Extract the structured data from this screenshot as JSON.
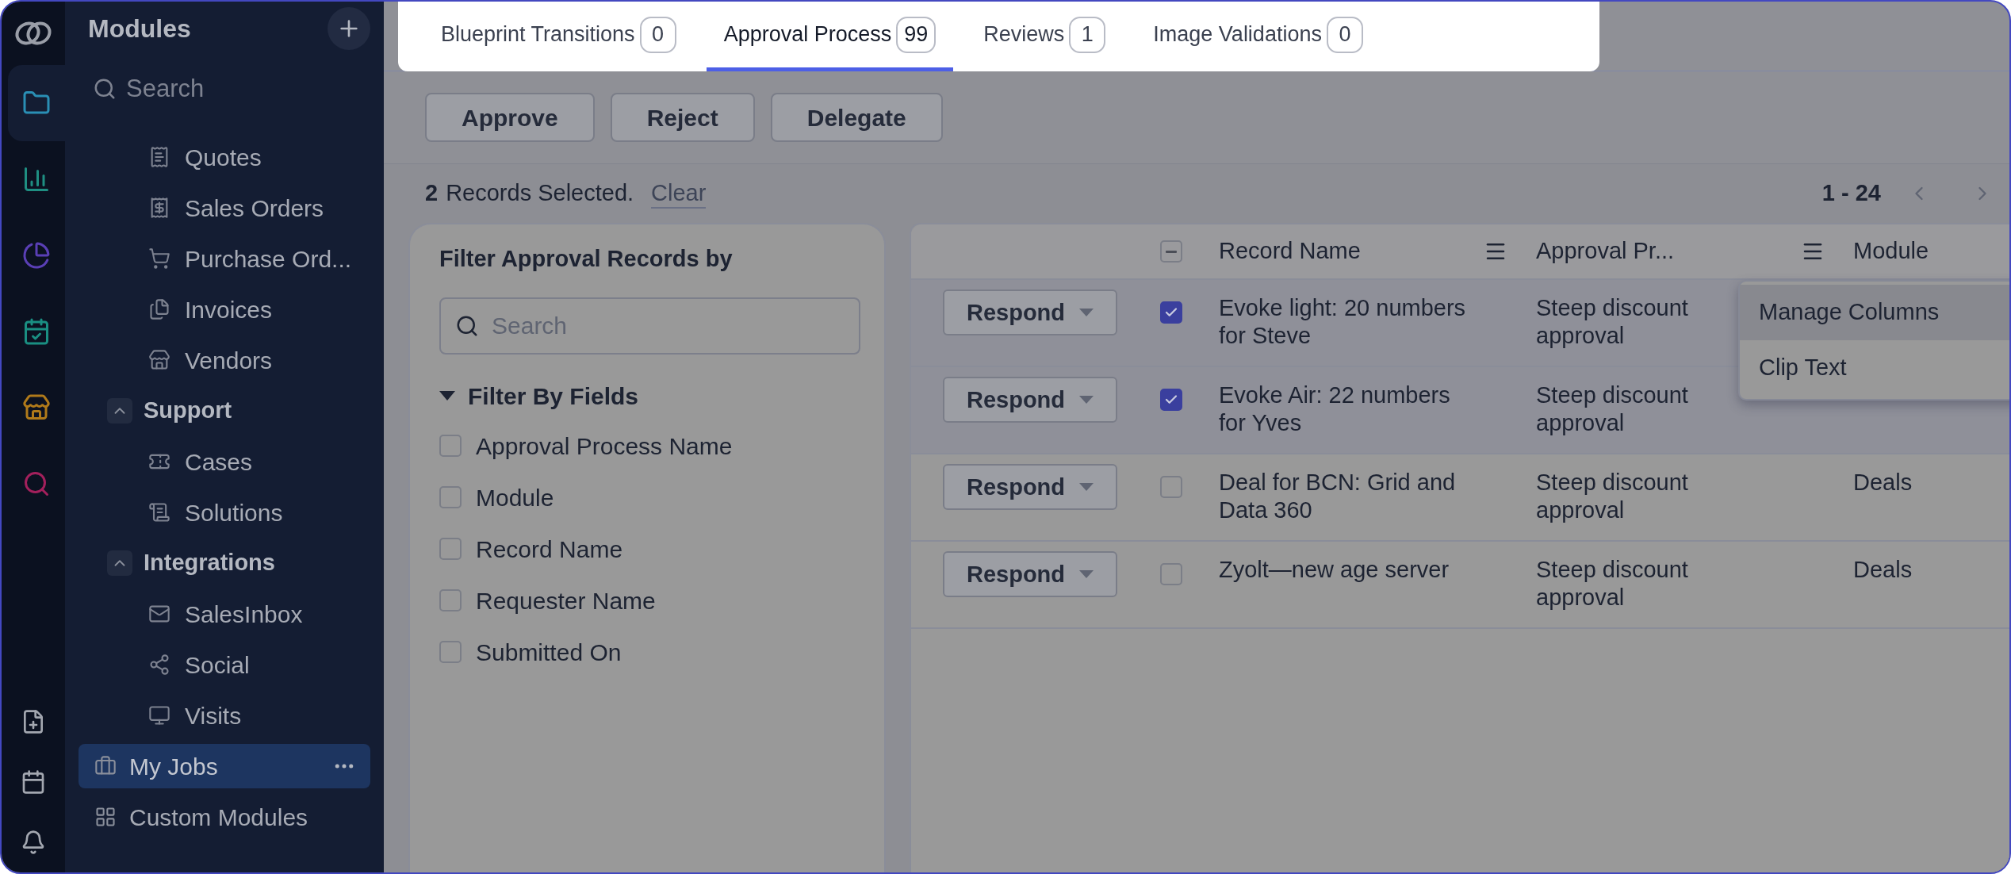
{
  "rail": {
    "top": [
      {
        "selected": true
      },
      {
        "selected": false
      },
      {
        "selected": false
      },
      {
        "selected": false
      },
      {
        "selected": false
      },
      {
        "selected": false
      }
    ],
    "bottom": [
      {
        "selected": false
      },
      {
        "selected": false
      },
      {
        "selected": false
      }
    ]
  },
  "sidebar": {
    "title": "Modules",
    "search": {
      "placeholder": "Search"
    },
    "sections": [
      {
        "children": [
          {
            "label": "Quotes"
          },
          {
            "label": "Sales Orders"
          },
          {
            "label": "Purchase Ord..."
          },
          {
            "label": "Invoices"
          },
          {
            "label": "Vendors"
          }
        ]
      },
      {
        "label": "Support",
        "expanded": true,
        "children": [
          {
            "label": "Cases"
          },
          {
            "label": "Solutions"
          }
        ]
      },
      {
        "label": "Integrations",
        "expanded": true,
        "children": [
          {
            "label": "SalesInbox"
          },
          {
            "label": "Social"
          },
          {
            "label": "Visits"
          }
        ]
      }
    ],
    "items": [
      {
        "label": "My Jobs",
        "selected": true
      },
      {
        "label": "Custom Modules",
        "selected": false
      }
    ]
  },
  "tabs": [
    {
      "label": "Blueprint Transitions",
      "count": "0",
      "selected": false
    },
    {
      "label": "Approval Process",
      "count": "99",
      "selected": true
    },
    {
      "label": "Reviews",
      "count": "1",
      "selected": false
    },
    {
      "label": "Image Validations",
      "count": "0",
      "selected": false
    }
  ],
  "toolbar": {
    "buttons": [
      "Approve",
      "Reject",
      "Delegate"
    ]
  },
  "selection": {
    "count": "2",
    "text": "Records Selected.",
    "link": "Clear"
  },
  "pagination": {
    "range": "1 - 24"
  },
  "filter": {
    "title": "Filter Approval Records by",
    "search": {
      "placeholder": "Search"
    },
    "section": {
      "label": "Filter By Fields",
      "expanded": true
    },
    "fields": [
      {
        "label": "Approval Process Name",
        "checked": false
      },
      {
        "label": "Module",
        "checked": false
      },
      {
        "label": "Record Name",
        "checked": false
      },
      {
        "label": "Requester Name",
        "checked": false
      },
      {
        "label": "Submitted On",
        "checked": false
      }
    ]
  },
  "table": {
    "header_indeterminate": true,
    "columns": [
      "Record Name",
      "Approval Pr...",
      "Module"
    ],
    "rows": [
      {
        "action": "Respond",
        "selected": true,
        "record_name": "Evoke light: 20 numbers for Steve",
        "approval_process": "Steep discount approval"
      },
      {
        "action": "Respond",
        "selected": true,
        "record_name": "Evoke Air: 22 numbers for Yves",
        "approval_process": "Steep discount approval"
      },
      {
        "action": "Respond",
        "selected": false,
        "record_name": "Deal for BCN: Grid and Data 360",
        "approval_process": "Steep discount approval",
        "module": "Deals"
      },
      {
        "action": "Respond",
        "selected": false,
        "record_name": "Zyolt—new age server",
        "approval_process": "Steep discount approval",
        "module": "Deals"
      }
    ]
  },
  "column_menu": {
    "items": [
      {
        "label": "Manage Columns",
        "highlighted": true
      },
      {
        "label": "Clip Text",
        "highlighted": false
      }
    ]
  }
}
